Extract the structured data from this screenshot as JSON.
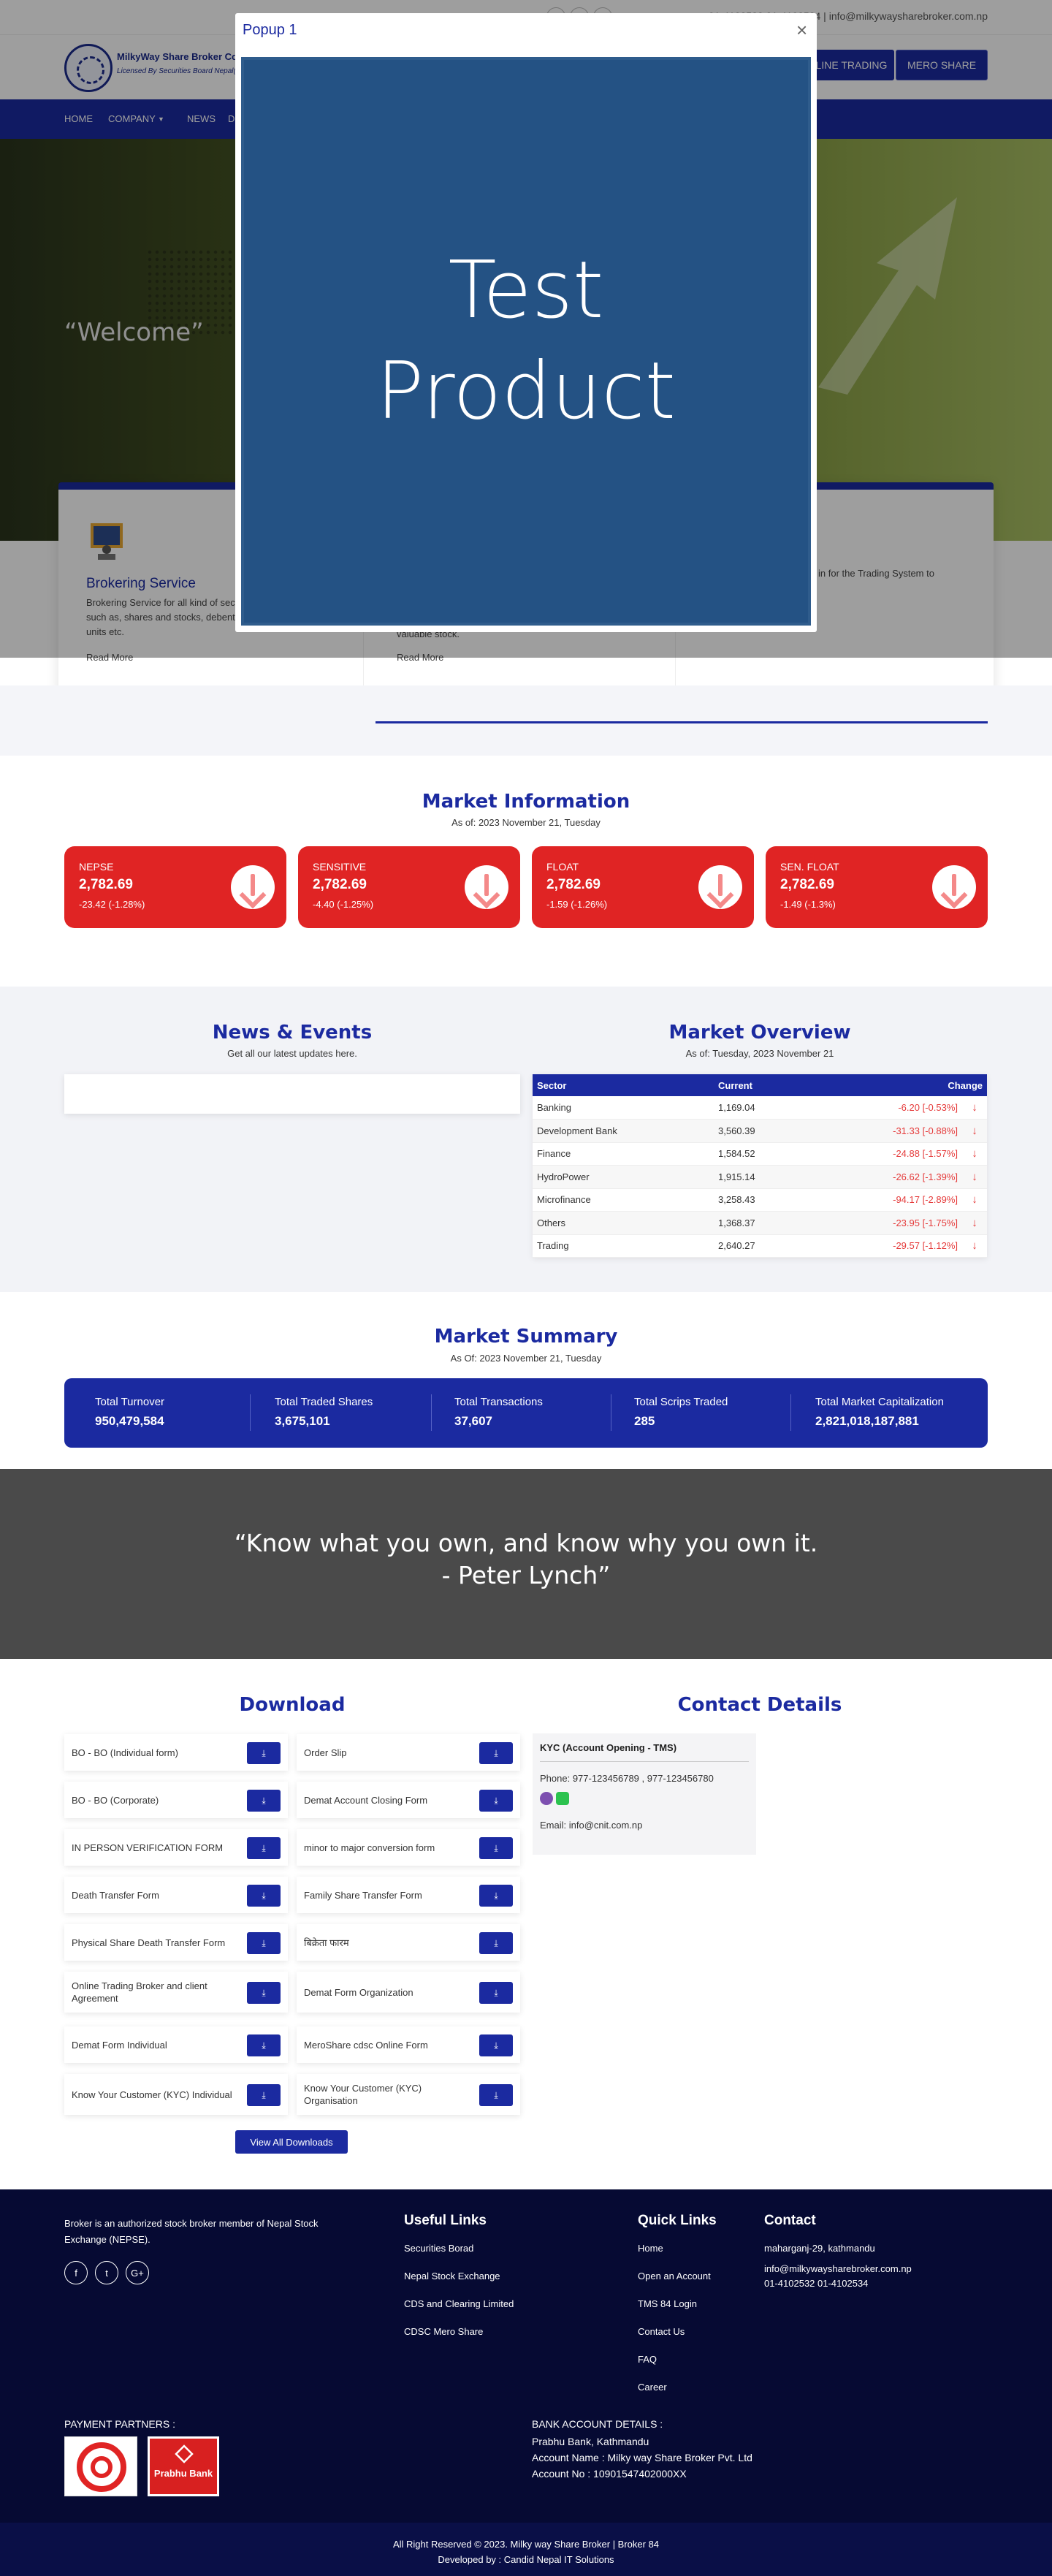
{
  "topbar": {
    "contact": "01-4102532 01-4102534 | info@milkywaysharebroker.com.np"
  },
  "header": {
    "brand": "MilkyWay Share Broker Co.",
    "brand_sub": "Licensed By Securities Board Nepal(SEBON)",
    "buttons": [
      "ONLINE TRADING",
      "MERO SHARE"
    ]
  },
  "nav": [
    "HOME",
    "COMPANY",
    "NEWS",
    "D"
  ],
  "hero": {
    "welcome": "“Welcome”"
  },
  "services": [
    {
      "title": "Brokering Service",
      "text": "Brokering Service for all kind of securities listed in NEPSE, such as, shares and stocks, debentures, bonds, mutual fund units etc.",
      "more": "Read More"
    },
    {
      "title": "",
      "text": "valuable stock.",
      "more": "Read More"
    },
    {
      "title": "",
      "text": "in for the Trading System to",
      "more": ""
    }
  ],
  "popup": {
    "title": "Popup 1",
    "close": "×",
    "image_text": "Test\nProduct"
  },
  "market_info": {
    "title": "Market Information",
    "asof": "As of: 2023 November 21, Tuesday",
    "cards": [
      {
        "name": "NEPSE",
        "value": "2,782.69",
        "change": "-23.42  (-1.28%)"
      },
      {
        "name": "SENSITIVE",
        "value": "2,782.69",
        "change": "-4.40  (-1.25%)"
      },
      {
        "name": "FLOAT",
        "value": "2,782.69",
        "change": "-1.59  (-1.26%)"
      },
      {
        "name": "SEN. FLOAT",
        "value": "2,782.69",
        "change": "-1.49  (-1.3%)"
      }
    ]
  },
  "news": {
    "title": "News & Events",
    "sub": "Get all our latest updates here."
  },
  "overview": {
    "title": "Market Overview",
    "asof": "As of: Tuesday, 2023 November 21",
    "headers": [
      "Sector",
      "Current",
      "Change"
    ],
    "rows": [
      [
        "Banking",
        "1,169.04",
        "-6.20 [-0.53%]"
      ],
      [
        "Development Bank",
        "3,560.39",
        "-31.33 [-0.88%]"
      ],
      [
        "Finance",
        "1,584.52",
        "-24.88 [-1.57%]"
      ],
      [
        "HydroPower",
        "1,915.14",
        "-26.62 [-1.39%]"
      ],
      [
        "Microfinance",
        "3,258.43",
        "-94.17 [-2.89%]"
      ],
      [
        "Others",
        "1,368.37",
        "-23.95 [-1.75%]"
      ],
      [
        "Trading",
        "2,640.27",
        "-29.57 [-1.12%]"
      ]
    ]
  },
  "summary": {
    "title": "Market Summary",
    "asof": "As Of: 2023 November 21, Tuesday",
    "items": [
      {
        "label": "Total Turnover",
        "value": "950,479,584"
      },
      {
        "label": "Total Traded Shares",
        "value": "3,675,101"
      },
      {
        "label": "Total Transactions",
        "value": "37,607"
      },
      {
        "label": "Total Scrips Traded",
        "value": "285"
      },
      {
        "label": "Total Market Capitalization",
        "value": "2,821,018,187,881"
      }
    ]
  },
  "quote": "“Know what you own, and know why you own it. - Peter Lynch”",
  "downloads": {
    "title": "Download",
    "left": [
      "BO - BO (Individual form)",
      "BO - BO (Corporate)",
      "IN PERSON VERIFICATION FORM",
      "Death Transfer Form",
      "Physical Share Death Transfer Form",
      "Online Trading Broker and client Agreement",
      "Demat Form Individual",
      "Know Your Customer (KYC) Individual"
    ],
    "right": [
      "Order Slip",
      "Demat Account Closing Form",
      "minor to major conversion form",
      "Family Share Transfer Form",
      "बिक्रेता फारम",
      "Demat Form Organization",
      "MeroShare cdsc Online Form",
      "Know Your Customer (KYC) Organisation"
    ],
    "view_all": "View All Downloads"
  },
  "contact_details": {
    "title": "Contact Details",
    "kyc_title": "KYC (Account Opening - TMS)",
    "phone": "Phone: 977-123456789 , 977-123456780",
    "email": "Email: info@cnit.com.np"
  },
  "footer": {
    "about": "Broker is an authorized stock broker member of Nepal Stock Exchange (NEPSE).",
    "useful_title": "Useful Links",
    "useful": [
      "Securities Borad",
      "Nepal Stock Exchange",
      "CDS and Clearing Limited",
      "CDSC Mero Share"
    ],
    "quick_title": "Quick Links",
    "quick": [
      "Home",
      "Open an Account",
      "TMS 84 Login",
      "Contact Us",
      "FAQ",
      "Career"
    ],
    "contact_title": "Contact",
    "address": "maharganj-29, kathmandu",
    "email": "info@milkywaysharebroker.com.np",
    "phone": "01-4102532  01-4102534",
    "payment_title": "PAYMENT PARTNERS :",
    "partner2": "Prabhu Bank",
    "bank_title": "BANK ACCOUNT DETAILS :",
    "bank_name": "Prabhu Bank, Kathmandu",
    "account_name": "Account Name : Milky way Share Broker Pvt. Ltd",
    "account_no": "Account No : 10901547402000XX",
    "copyright": "All Right Reserved © 2023. Milky way Share Broker | Broker 84",
    "developed": "Developed by : Candid Nepal IT Solutions"
  }
}
